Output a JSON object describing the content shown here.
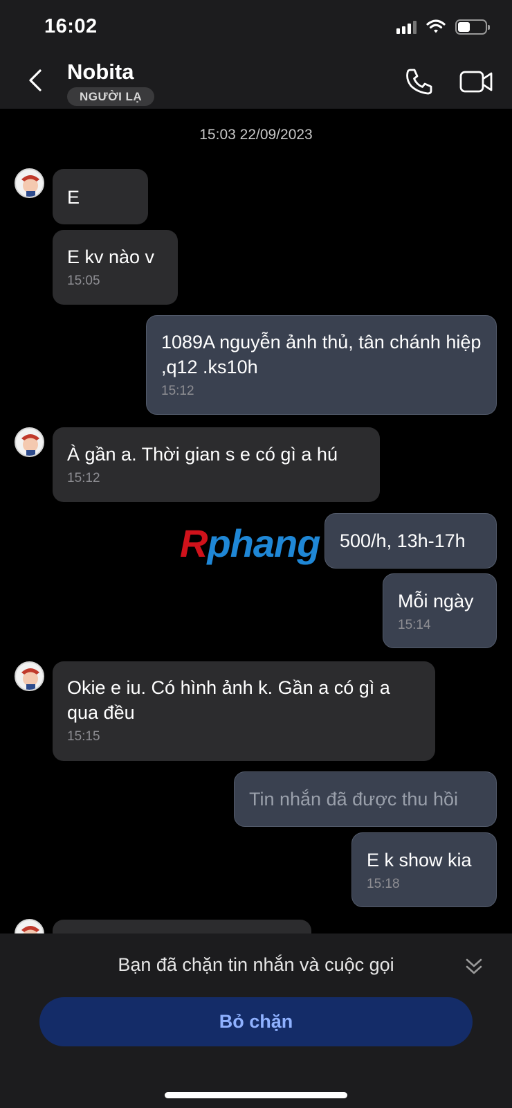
{
  "status_bar": {
    "time": "16:02",
    "battery_level": 0.45
  },
  "header": {
    "contact_name": "Nobita",
    "badge": "NGƯỜI LẠ",
    "icons": [
      "back-icon",
      "phone-icon",
      "video-camera-icon"
    ]
  },
  "chat": {
    "date_separator": "15:03 22/09/2023",
    "messages": [
      {
        "side": "in",
        "text": "E",
        "time": ""
      },
      {
        "side": "in",
        "text": "E kv nào v",
        "time": "15:05"
      },
      {
        "side": "out",
        "text": "1089A nguyễn ảnh thủ, tân chánh hiệp ,q12 .ks10h",
        "time": "15:12"
      },
      {
        "side": "in",
        "text": "À gần a. Thời gian s e có gì a hú",
        "time": "15:12"
      },
      {
        "side": "out",
        "text": "500/h, 13h-17h",
        "time": ""
      },
      {
        "side": "out",
        "text": "Mỗi ngày",
        "time": "15:14"
      },
      {
        "side": "in",
        "text": "Okie e iu. Có hình ảnh k. Gần a có gì a qua đều",
        "time": "15:15"
      },
      {
        "side": "out",
        "text": "Tin nhắn đã được thu hồi",
        "time": "",
        "recalled": true
      },
      {
        "side": "out",
        "text": "E k show kia",
        "time": "15:18"
      }
    ]
  },
  "watermark": {
    "first_letter": "R",
    "rest": "phang"
  },
  "bottom": {
    "blocked_notice": "Bạn đã chặn tin nhắn và cuộc gọi",
    "unblock_label": "Bỏ chặn"
  },
  "colors": {
    "accent_button": "#142c68",
    "accent_text": "#8fb1ff",
    "out_bubble": "#3a4150",
    "in_bubble": "#2c2c2e"
  }
}
